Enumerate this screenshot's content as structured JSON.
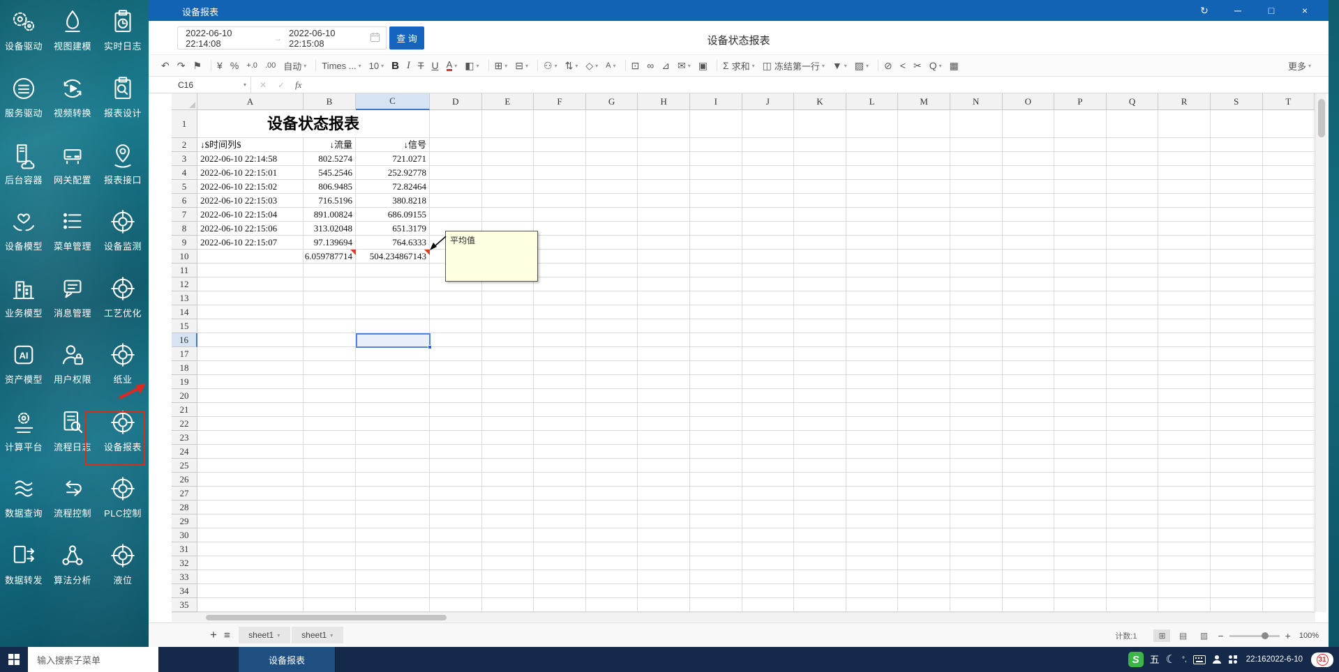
{
  "titlebar": {
    "title": "设备报表",
    "controls": [
      {
        "name": "refresh-icon",
        "glyph": "↻"
      },
      {
        "name": "minimize-icon",
        "glyph": "─"
      },
      {
        "name": "maximize-icon",
        "glyph": "□"
      },
      {
        "name": "close-icon",
        "glyph": "×"
      }
    ]
  },
  "query": {
    "start": "2022-06-10 22:14:08",
    "range_arrow": "→",
    "end": "2022-06-10 22:15:08",
    "button": "查 询",
    "report_title": "设备状态报表"
  },
  "toolbar": {
    "items": [
      {
        "name": "undo-icon",
        "glyph": "↶"
      },
      {
        "name": "redo-icon",
        "glyph": "↷"
      },
      {
        "name": "format-painter-icon",
        "glyph": "⚑"
      },
      {
        "type": "sep"
      },
      {
        "name": "currency-icon",
        "glyph": "¥"
      },
      {
        "name": "percent-icon",
        "glyph": "%"
      },
      {
        "name": "increase-decimal-icon",
        "glyph": "+.0",
        "small": true
      },
      {
        "name": "decrease-decimal-icon",
        "glyph": ".00",
        "small": true
      },
      {
        "name": "number-format-select",
        "label": "自动",
        "dd": true
      },
      {
        "type": "sep"
      },
      {
        "name": "font-family-select",
        "label": "Times ...",
        "dd": true
      },
      {
        "name": "font-size-select",
        "label": "10",
        "dd": true
      },
      {
        "name": "bold-button",
        "glyph": "B",
        "cls": "b"
      },
      {
        "name": "italic-button",
        "glyph": "I",
        "cls": "i"
      },
      {
        "name": "strikethrough-button",
        "glyph": "T",
        "cls": "strike"
      },
      {
        "name": "underline-button",
        "glyph": "U",
        "cls": "u"
      },
      {
        "name": "font-color-button",
        "glyph": "A",
        "cls": "fcolor",
        "dd": true
      },
      {
        "name": "fill-color-icon",
        "glyph": "◧",
        "dd": true
      },
      {
        "type": "sep"
      },
      {
        "name": "borders-icon",
        "glyph": "⊞",
        "dd": true
      },
      {
        "name": "merge-cells-icon",
        "glyph": "⊟",
        "dd": true
      },
      {
        "type": "sep"
      },
      {
        "name": "permission-icon",
        "glyph": "⚇",
        "dd": true
      },
      {
        "name": "vertical-align-icon",
        "glyph": "⇅",
        "dd": true
      },
      {
        "name": "view-3d-icon",
        "glyph": "◇",
        "dd": true
      },
      {
        "name": "phonetic-icon",
        "glyph": "A",
        "small": true,
        "dd": true
      },
      {
        "type": "sep"
      },
      {
        "name": "insert-image-icon",
        "glyph": "⊡"
      },
      {
        "name": "insert-link-icon",
        "glyph": "∞"
      },
      {
        "name": "insert-chart-icon",
        "glyph": "⊿"
      },
      {
        "name": "comment-icon",
        "glyph": "✉",
        "dd": true
      },
      {
        "name": "protect-icon",
        "glyph": "▣"
      },
      {
        "type": "sep"
      },
      {
        "name": "sum-button",
        "glyph": "Σ",
        "label": "求和",
        "dd": true
      },
      {
        "name": "freeze-button",
        "glyph": "◫",
        "label": "冻结第一行",
        "dd": true
      },
      {
        "name": "filter-icon",
        "glyph": "▼",
        "dd": true
      },
      {
        "name": "pattern-icon",
        "glyph": "▨",
        "dd": true
      },
      {
        "type": "sep"
      },
      {
        "name": "clear-icon",
        "glyph": "⊘"
      },
      {
        "name": "share-icon",
        "glyph": "<"
      },
      {
        "name": "cut-icon",
        "glyph": "✂"
      },
      {
        "name": "find-icon",
        "glyph": "Q",
        "dd": true
      },
      {
        "name": "calculator-icon",
        "glyph": "▦"
      },
      {
        "type": "spacer"
      },
      {
        "name": "more-button",
        "label": "更多",
        "dd": true
      }
    ]
  },
  "formula": {
    "cell_ref": "C16",
    "cancel": "✕",
    "confirm": "✓",
    "fx": "fx"
  },
  "sheet": {
    "columns": [
      "A",
      "B",
      "C",
      "D",
      "E",
      "F",
      "G",
      "H",
      "I",
      "J",
      "K",
      "L",
      "M",
      "N",
      "O",
      "P",
      "Q",
      "R",
      "S",
      "T"
    ],
    "selected_cell": "C16",
    "selected_column": "C",
    "selected_row": 16,
    "visible_rows": 35,
    "title": "设备状态报表",
    "header_row": [
      "↓$时间列$",
      "↓流量",
      "↓信号"
    ],
    "rows": [
      [
        "2022-06-10 22:14:58",
        "802.5274",
        "721.0271"
      ],
      [
        "2022-06-10 22:15:01",
        "545.2546",
        "252.92778"
      ],
      [
        "2022-06-10 22:15:02",
        "806.9485",
        "72.82464"
      ],
      [
        "2022-06-10 22:15:03",
        "716.5196",
        "380.8218"
      ],
      [
        "2022-06-10 22:15:04",
        "891.00824",
        "686.09155"
      ],
      [
        "2022-06-10 22:15:06",
        "313.02048",
        "651.3179"
      ],
      [
        "2022-06-10 22:15:07",
        "97.139694",
        "764.6333"
      ]
    ],
    "summary_row": [
      "",
      "6.059787714",
      "504.234867143"
    ],
    "comment": {
      "text": "平均值"
    },
    "tabs": [
      {
        "label": "sheet1"
      },
      {
        "label": "sheet1"
      }
    ]
  },
  "statusbar": {
    "count": "计数:1",
    "view_icons": [
      {
        "name": "view-normal-icon",
        "glyph": "⊞",
        "selected": true
      },
      {
        "name": "view-page-icon",
        "glyph": "▤",
        "selected": false
      },
      {
        "name": "view-break-icon",
        "glyph": "▥",
        "selected": false
      }
    ],
    "zoom_minus": "−",
    "zoom_plus": "+",
    "zoom": "100%"
  },
  "sidebar": {
    "items": [
      {
        "label": "设备驱动",
        "icon": "gears-icon"
      },
      {
        "label": "视图建模",
        "icon": "flame-icon"
      },
      {
        "label": "实时日志",
        "icon": "clipboard-clock-icon"
      },
      {
        "label": "服务驱动",
        "icon": "server-circle-icon"
      },
      {
        "label": "视频转换",
        "icon": "video-convert-icon"
      },
      {
        "label": "报表设计",
        "icon": "clipboard-search-icon"
      },
      {
        "label": "后台容器",
        "icon": "tower-cloud-icon"
      },
      {
        "label": "网关配置",
        "icon": "gateway-icon"
      },
      {
        "label": "报表接口",
        "icon": "pin-icon"
      },
      {
        "label": "设备模型",
        "icon": "hands-heart-icon"
      },
      {
        "label": "菜单管理",
        "icon": "list-icon"
      },
      {
        "label": "设备监测",
        "icon": "target-icon"
      },
      {
        "label": "业务模型",
        "icon": "building-icon"
      },
      {
        "label": "消息管理",
        "icon": "message-icon"
      },
      {
        "label": "工艺优化",
        "icon": "target-icon"
      },
      {
        "label": "资产模型",
        "icon": "ai-icon"
      },
      {
        "label": "用户权限",
        "icon": "user-lock-icon"
      },
      {
        "label": "纸业",
        "icon": "target-icon"
      },
      {
        "label": "计算平台",
        "icon": "compute-icon"
      },
      {
        "label": "流程日志",
        "icon": "doc-search-icon"
      },
      {
        "label": "设备报表",
        "icon": "target-icon"
      },
      {
        "label": "数据查询",
        "icon": "layers-icon"
      },
      {
        "label": "流程控制",
        "icon": "flow-icon"
      },
      {
        "label": "PLC控制",
        "icon": "target-icon"
      },
      {
        "label": "数据转发",
        "icon": "forward-icon"
      },
      {
        "label": "算法分析",
        "icon": "network-icon"
      },
      {
        "label": "液位",
        "icon": "target-icon"
      }
    ]
  },
  "taskbar": {
    "search_placeholder": "输入搜索子菜单",
    "active_task": "设备报表",
    "tray": {
      "ime_icon": "S",
      "ime_mode": "五",
      "moon_glyph": "☾",
      "deg_glyph": "°,",
      "time": "22:16",
      "date": "2022-6-10",
      "badge": "31"
    }
  }
}
